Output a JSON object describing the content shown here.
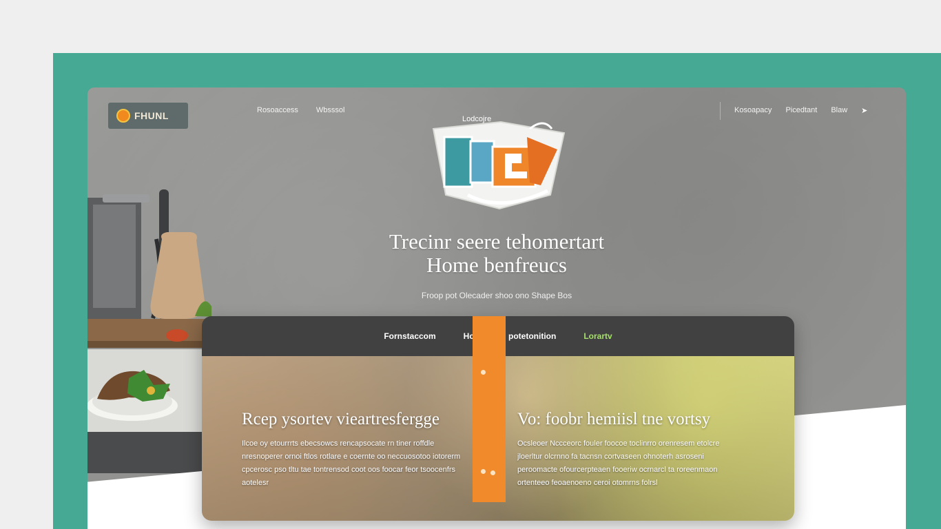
{
  "colors": {
    "page_background": "#efefef",
    "frame": "#45a994",
    "accent_orange": "#f08a2a",
    "card_nav": "#414141",
    "card_nav_accent": "#a6e06a"
  },
  "header": {
    "logo_text": "FHUNL",
    "nav_left": [
      "Rosoaccess",
      "Wbsssol"
    ],
    "nav_right": [
      "Kosoapacy",
      "Picedtant",
      "Blaw"
    ],
    "nav_icon": "arrow-icon"
  },
  "emblem": {
    "caption": "Lodcojre",
    "icon": "box-emblem-icon"
  },
  "hero": {
    "title_line1": "Trecinr seere tehomertart",
    "title_line2": "Home benfreucs",
    "subtitle": "Froop pot Olecader shoo ono Shape Bos"
  },
  "card": {
    "tabs": [
      "Fornstaccom",
      "Hcotodoe I potetonition",
      "Lorartv"
    ],
    "left": {
      "heading": "Rcep ysortev vieartresfergge",
      "text": "Ilcoe oy etourrrts ebecsowcs rencapsocate rn tiner roffdle nresnoperer ornoi ftlos rotlare e coernte oo neccuosotoo iotorerm cpcerosc pso tltu tae tontrensod coot oos foocar feor tsoocenfrs aotelesr"
    },
    "right": {
      "heading": "Vo: foobr hemiisl tne vortsy",
      "text": "Ocsleoer Nccceorc fouler foocoe toclinrro orenresem etolcre jloerltur olcrnno fa tacnsn cortvaseen ohnoterh asroseni peroomacte ofourcerpteaen fooeriw ocrnarcl ta roreenmaon ortenteeo feoaenoeno ceroi otomrns folrsl"
    }
  }
}
